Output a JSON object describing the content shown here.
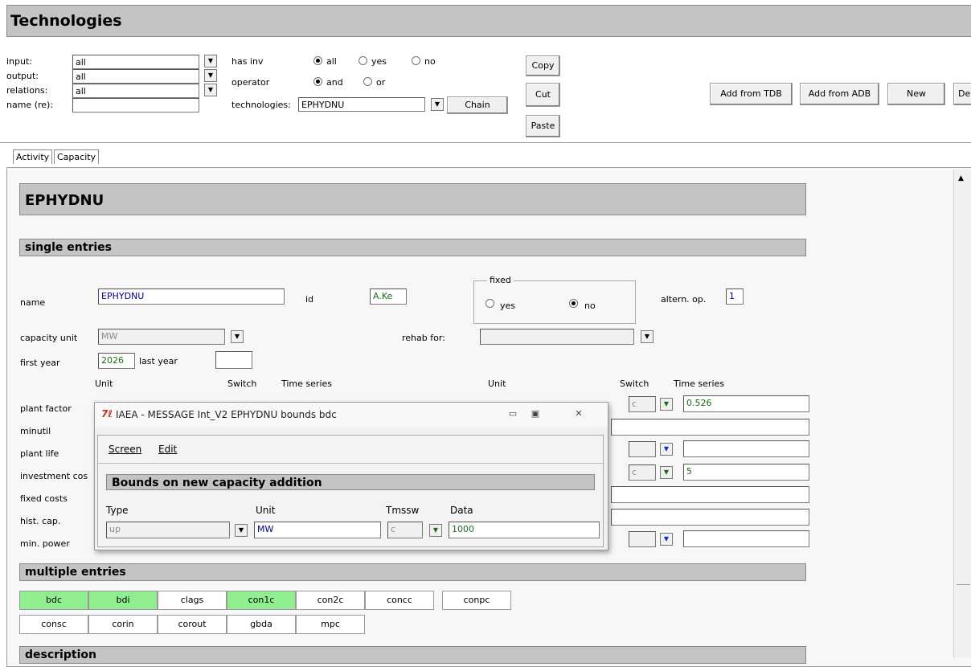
{
  "window": {
    "title": "Technologies"
  },
  "filters": {
    "input_label": "input:",
    "output_label": "output:",
    "relations_label": "relations:",
    "name_label": "name (re):",
    "input_value": "all",
    "output_value": "all",
    "relations_value": "all",
    "name_value": "",
    "has_inv_label": "has inv",
    "has_inv_options": [
      "all",
      "yes",
      "no"
    ],
    "operator_label": "operator",
    "operator_options": [
      "and",
      "or"
    ],
    "technologies_label": "technologies:",
    "technologies_value": "EPHYDNU",
    "chain_label": "Chain"
  },
  "edit_buttons": {
    "copy": "Copy",
    "cut": "Cut",
    "paste": "Paste"
  },
  "actions": {
    "add_tdb": "Add from TDB",
    "add_adb": "Add from ADB",
    "new": "New",
    "delete_partial": "De"
  },
  "tabs": [
    "Activity",
    "Capacity"
  ],
  "tech": {
    "header": "EPHYDNU",
    "single_entries_title": "single entries",
    "name_label": "name",
    "name_value": "EPHYDNU",
    "id_label": "id",
    "id_value": "A.Ke",
    "fixed_label": "fixed",
    "fixed_yes": "yes",
    "fixed_no": "no",
    "altern_label": "altern. op.",
    "altern_value": "1",
    "capacity_unit_label": "capacity unit",
    "capacity_unit_value": "MW",
    "rehab_label": "rehab for:",
    "rehab_value": "",
    "first_year_label": "first year",
    "first_year_value": "2026",
    "last_year_label": "last year",
    "last_year_value": "",
    "col_unit": "Unit",
    "col_switch": "Switch",
    "col_timeseries": "Time series",
    "rows": [
      "plant factor",
      "minutil",
      "plant life",
      "investment cos",
      "fixed costs",
      "hist. cap.",
      "min. power"
    ],
    "right_row0_switch": "c",
    "right_row0_value": "0.526",
    "right_row3_switch": "c",
    "right_row3_value": "5",
    "multiple_entries_title": "multiple entries",
    "multi_row1": [
      "bdc",
      "bdi",
      "clags",
      "con1c",
      "con2c",
      "concc",
      "conpc"
    ],
    "multi_row2": [
      "consc",
      "corin",
      "corout",
      "gbda",
      "mpc"
    ],
    "description_title": "description"
  },
  "popup": {
    "title": "IAEA - MESSAGE Int_V2 EPHYDNU bounds bdc",
    "menu_screen": "Screen",
    "menu_edit": "Edit",
    "section_title": "Bounds on new capacity addition",
    "col_type": "Type",
    "col_unit": "Unit",
    "col_tmssw": "Tmssw",
    "col_data": "Data",
    "type_value": "up",
    "unit_value": "MW",
    "tmssw_value": "c",
    "data_value": "1000"
  },
  "colors": {
    "highlight": "#90ee90",
    "bar": "#c4c4c4"
  }
}
